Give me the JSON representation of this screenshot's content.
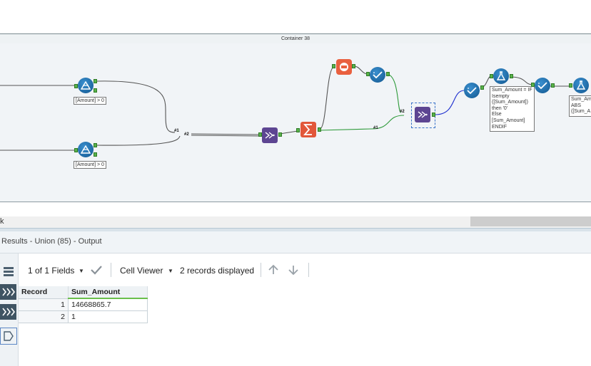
{
  "canvas": {
    "container_title": "Container 38",
    "filters": [
      {
        "condition": "[Amount] > 0"
      },
      {
        "condition": "[Amount] > 0"
      }
    ],
    "union_input_labels": [
      "#1",
      "#2"
    ],
    "second_union_input_labels": [
      "#1",
      "#2"
    ],
    "formula_1": [
      "Sum_Amount = IF",
      "Isempty",
      "([Sum_Amount])",
      "then '0'",
      "Else",
      "[Sum_Amount]",
      "ENDIF"
    ],
    "formula_2": [
      "Sum_Amo",
      "ABS",
      "([Sum_A"
    ],
    "scroll_fragment": "k"
  },
  "results": {
    "title": "Results - Union (85) - Output",
    "fields_selector": "1 of 1 Fields",
    "cell_viewer": "Cell Viewer",
    "records_displayed": "2 records displayed",
    "columns": [
      "Record",
      "Sum_Amount"
    ],
    "rows": [
      {
        "record": "1",
        "sum_amount": "14668865.7"
      },
      {
        "record": "2",
        "sum_amount": "1"
      }
    ]
  },
  "colors": {
    "tool_blue": "#1f77b4",
    "union_purple": "#5d4592",
    "summarize_orange": "#e2573a",
    "anchor_green": "#59b24a",
    "connection_blue": "#1e2fcf",
    "connection_green": "#2e9a3a"
  }
}
